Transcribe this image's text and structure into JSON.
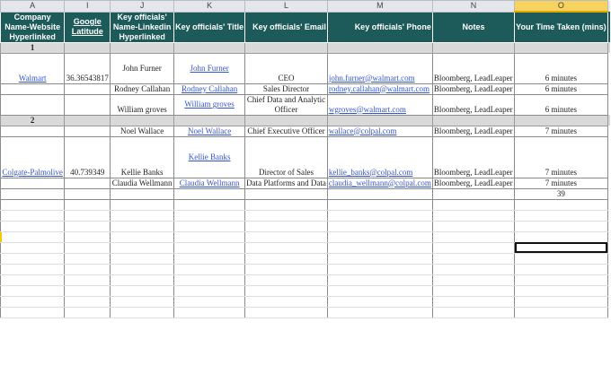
{
  "columns": [
    "A",
    "I",
    "J",
    "K",
    "L",
    "M",
    "N",
    "O"
  ],
  "headers": [
    "Company Name-Website Hyperlinked",
    "Google Latitude",
    "Key officials' Name-Linkedin Hyperlinked",
    "Key officials' Title",
    "Key officials' Email",
    "Key officials' Phone",
    "Notes",
    "Your Time Taken (mins)"
  ],
  "groups": [
    "1",
    "2"
  ],
  "rows": [
    {
      "company": "Walmart",
      "lat": "36.36543817",
      "name": "John Furner",
      "link": "John Furner",
      "title": "CEO",
      "email": "john.furner@walmart.com",
      "notes": "Bloomberg,  LeadLeaper",
      "time": "6 minutes"
    },
    {
      "company": "",
      "lat": "",
      "name": "Rodney Callahan",
      "link": "Rodney Callahan",
      "title": "Sales Director",
      "email": "rodney.callahan@walmart.com",
      "notes": "Bloomberg,  LeadLeaper",
      "time": "6 minutes"
    },
    {
      "company": "",
      "lat": "",
      "name": "William groves",
      "link": "William groves",
      "title": "Chief Data and Analytic Officer",
      "email": "wgroves@walmart.com",
      "notes": "Bloomberg,  LeadLeaper",
      "time": "6 minutes"
    },
    {
      "company": "",
      "lat": "",
      "name": "Noel Wallace",
      "link": "Noel Wallace",
      "title": "Chief Executive Officer",
      "email": "wallace@colpal.com",
      "notes": "Bloomberg,  LeadLeaper",
      "time": "7 minutes"
    },
    {
      "company": "Colgate-Palmolive",
      "lat": "40.739349",
      "name": "Kellie Banks",
      "link": "Kellie Banks",
      "title": "Director of Sales",
      "email": "kellie_banks@colpal.com",
      "notes": "Bloomberg,  LeadLeaper",
      "time": "7 minutes"
    },
    {
      "company": "",
      "lat": "",
      "name": "Claudia Wellmann",
      "link": "Claudia Wellmann",
      "title": "Data Platforms and Data",
      "email": "claudia_wellmann@colpal.com",
      "notes": "Bloomberg,  LeadLeaper",
      "time": "7 minutes"
    }
  ],
  "total_time": "39"
}
